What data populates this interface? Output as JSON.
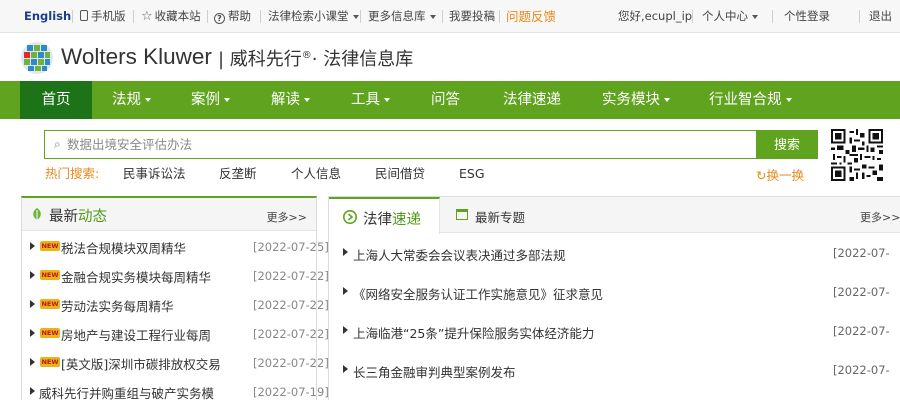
{
  "topbar": {
    "english": "English",
    "mobile": "手机版",
    "favorite": "收藏本站",
    "help": "帮助",
    "law_class": "法律检索小课堂",
    "more_info": "更多信息库",
    "submit": "我要投稿",
    "feedback": "问题反馈",
    "greeting": "您好,ecupl_ip",
    "personal_center": "个人中心",
    "personal_login": "个性登录",
    "logout": "退出"
  },
  "brand": {
    "name": "Wolters Kluwer",
    "sub_name": "威科先行",
    "registered": "®",
    "sub_suffix": "· 法律信息库",
    "colors": {
      "green": "#5fa31e",
      "dark_green": "#1d7318",
      "orange": "#e8891a"
    }
  },
  "nav": {
    "items": [
      {
        "label": "首页",
        "dropdown": false,
        "active": true
      },
      {
        "label": "法规",
        "dropdown": true
      },
      {
        "label": "案例",
        "dropdown": true
      },
      {
        "label": "解读",
        "dropdown": true
      },
      {
        "label": "工具",
        "dropdown": true
      },
      {
        "label": "问答",
        "dropdown": false
      },
      {
        "label": "法律速递",
        "dropdown": false
      },
      {
        "label": "实务模块",
        "dropdown": true
      },
      {
        "label": "行业智合规",
        "dropdown": true
      }
    ]
  },
  "search": {
    "placeholder": "数据出境安全评估办法",
    "button": "搜索",
    "hot_label": "热门搜索:",
    "hot_terms": [
      "民事诉讼法",
      "反垄断",
      "个人信息",
      "民间借贷",
      "ESG"
    ],
    "refresh": "换一换"
  },
  "left_panel": {
    "title_prefix": "最新",
    "title_highlight": "动态",
    "more": "更多>>",
    "badge": "NEW",
    "items": [
      {
        "title": "税法合规模块双周精华",
        "date": "[2022-07-25]",
        "new": true
      },
      {
        "title": "金融合规实务模块每周精华",
        "date": "[2022-07-22]",
        "new": true
      },
      {
        "title": "劳动法实务每周精华",
        "date": "[2022-07-22]",
        "new": true
      },
      {
        "title": "房地产与建设工程行业每周",
        "date": "[2022-07-22]",
        "new": true
      },
      {
        "title": "[英文版]深圳市碳排放权交易",
        "date": "[2022-07-22]",
        "new": true
      },
      {
        "title": "威科先行并购重组与破产实务模",
        "date": "[2022-07-19]",
        "new": false
      }
    ]
  },
  "right_panel": {
    "tab1_prefix": "法律",
    "tab1_highlight": "速递",
    "tab2": "最新专题",
    "more": "更多>>",
    "items": [
      {
        "title": "上海人大常委会会议表决通过多部法规",
        "date": "[2022-07-"
      },
      {
        "title": "《网络安全服务认证工作实施意见》征求意见",
        "date": "[2022-07-"
      },
      {
        "title": "上海临港“25条”提升保险服务实体经济能力",
        "date": "[2022-07-"
      },
      {
        "title": "长三角金融审判典型案例发布",
        "date": "[2022-07-"
      }
    ]
  }
}
